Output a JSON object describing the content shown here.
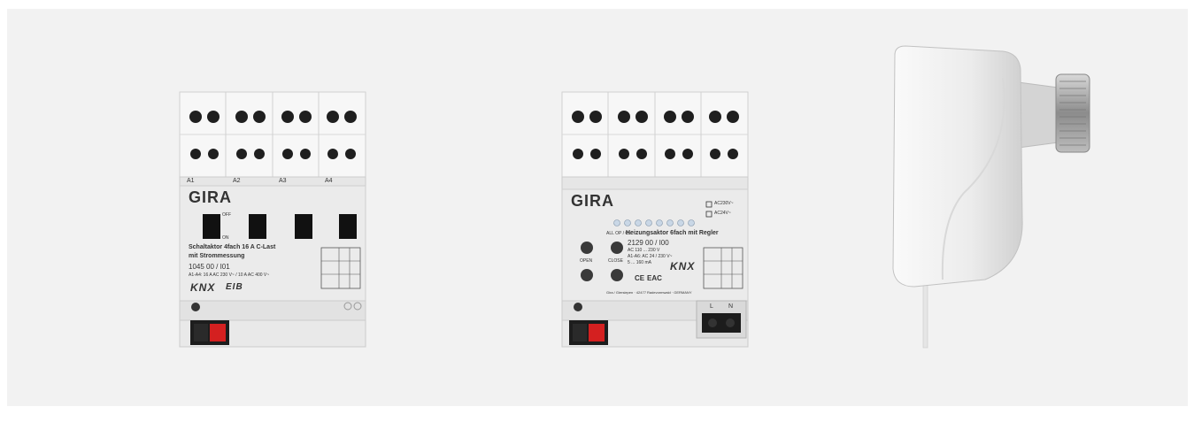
{
  "products": [
    {
      "brand": "GIRA",
      "channels": [
        "A1",
        "A2",
        "A3",
        "A4"
      ],
      "switch_states": [
        "OFF",
        "ON"
      ],
      "title_line1": "Schaltaktor 4fach 16 A C-Last",
      "title_line2": "mit Strommessung",
      "article_number": "1045 00 / I01",
      "rating": "A1-A4: 16 A AC 230 V~ / 10 A AC 400 V~",
      "knx_label": "KNX",
      "eib_label": "EIB"
    },
    {
      "brand": "GIRA",
      "title": "Heizungsaktor 6fach mit Regler",
      "article_number": "2129 00 / I00",
      "spec_line1": "AC 110 ... 230 V",
      "spec_line2": "A1-A6: AC 24 / 230 V~",
      "spec_line3": "5 ... 160 mA",
      "btn_all": "ALL OP / CL",
      "btn_open": "OPEN",
      "btn_close": "CLOSE",
      "voltage_opt1": "AC230V~",
      "voltage_opt2": "AC24V~",
      "knx_label": "KNX",
      "ce_label": "CE",
      "eac_label": "EAC",
      "terminal_l": "L",
      "terminal_n": "N",
      "address": "Gira / Giersiepen · 42477 Radevormwald · GERMANY"
    },
    {
      "name": "valve-drive"
    }
  ],
  "colors": {
    "panel_bg": "#f2f2f2",
    "device_white": "#ececec",
    "screw_dark": "#222222",
    "terminal_red": "#d42020"
  }
}
